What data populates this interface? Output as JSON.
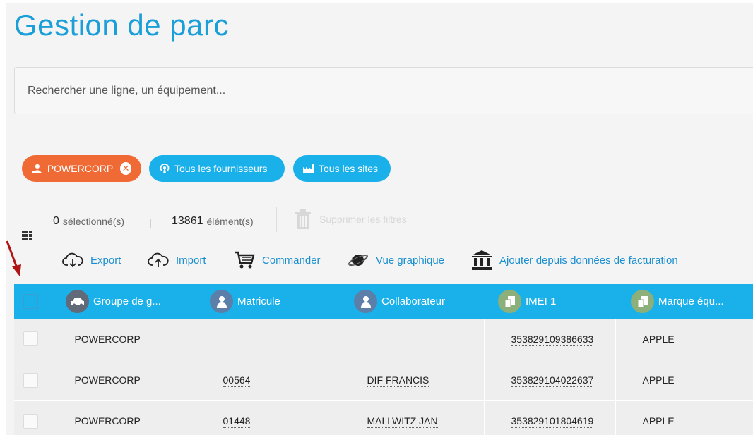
{
  "page_title": "Gestion de parc",
  "search": {
    "placeholder": "Rechercher une ligne, un équipement..."
  },
  "filters": {
    "company": "POWERCORP",
    "suppliers": "Tous les fournisseurs",
    "sites": "Tous les sites"
  },
  "stats": {
    "selected_count": "0",
    "selected_label": "sélectionné(s)",
    "separator": "|",
    "total_count": "13861",
    "total_label": "élément(s)"
  },
  "clear_filters_label": "Supprimer les filtres",
  "actions": {
    "export": "Export",
    "import": "Import",
    "order": "Commander",
    "graph_view": "Vue graphique",
    "add_from_billing": "Ajouter depuis données de facturation"
  },
  "table": {
    "columns": {
      "group": "Groupe de g...",
      "matricule": "Matricule",
      "collaborator": "Collaborateur",
      "imei1": "IMEI 1",
      "brand": "Marque équ..."
    },
    "rows": [
      {
        "group": "POWERCORP",
        "matricule": "",
        "collaborator": "",
        "imei1": "353829109386633",
        "brand": "APPLE"
      },
      {
        "group": "POWERCORP",
        "matricule": "00564",
        "collaborator": "DIF FRANCIS",
        "imei1": "353829104022637",
        "brand": "APPLE"
      },
      {
        "group": "POWERCORP",
        "matricule": "01448",
        "collaborator": "MALLWITZ JAN",
        "imei1": "353829101804619",
        "brand": "APPLE"
      }
    ]
  },
  "colors": {
    "accent_blue": "#1ab1ea",
    "title_blue": "#1a9fd9",
    "filter_orange": "#f06a35",
    "annotation_arrow": "#b01515"
  }
}
